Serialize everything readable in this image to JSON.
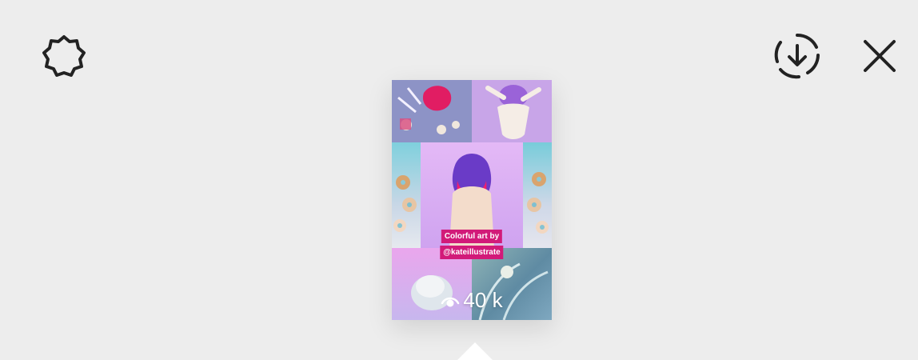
{
  "toolbar": {
    "settings_icon": "gear-icon",
    "download_icon": "download-icon",
    "close_icon": "close-icon"
  },
  "story": {
    "caption_line1": "Colorful art by",
    "caption_line2": "@kateillustrate",
    "views_icon": "eye-icon",
    "views_count": "40 k",
    "caption_color": "#d21a79"
  },
  "colors": {
    "background": "#ededed",
    "icon": "#222222"
  }
}
